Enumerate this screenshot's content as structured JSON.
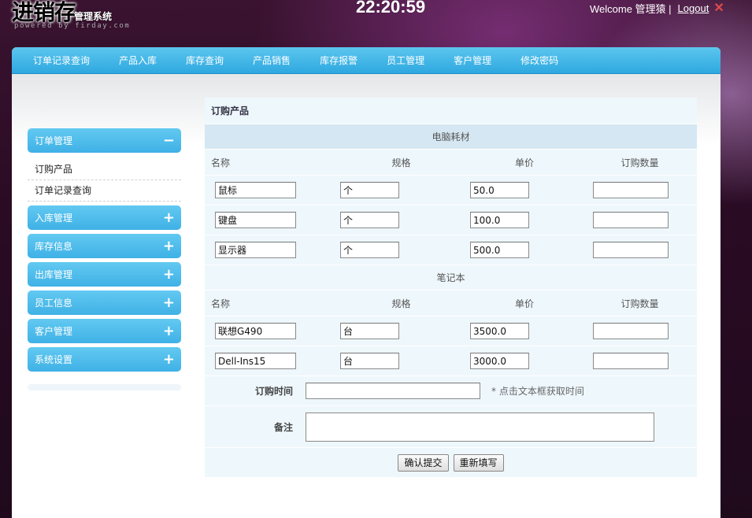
{
  "header": {
    "logo_main": "进销存",
    "logo_sub": "管理系统",
    "powered": "powered by firday.com",
    "clock": "22:20:59",
    "welcome": "Welcome 管理猿 |",
    "logout": "Logout"
  },
  "nav": [
    "订单记录查询",
    "产品入库",
    "库存查询",
    "产品销售",
    "库存报警",
    "员工管理",
    "客户管理",
    "修改密码"
  ],
  "sidebar": {
    "open_section": "订单管理",
    "open_symbol": "−",
    "sub_items": [
      "订购产品",
      "订单记录查询"
    ],
    "sections": [
      "入库管理",
      "库存信息",
      "出库管理",
      "员工信息",
      "客户管理",
      "系统设置"
    ],
    "closed_symbol": "+"
  },
  "form": {
    "title": "订购产品",
    "headers": [
      "名称",
      "规格",
      "单价",
      "订购数量"
    ],
    "categories": [
      {
        "name": "电脑耗材",
        "items": [
          {
            "name": "鼠标",
            "spec": "个",
            "price": "50.0",
            "qty": ""
          },
          {
            "name": "键盘",
            "spec": "个",
            "price": "100.0",
            "qty": ""
          },
          {
            "name": "显示器",
            "spec": "个",
            "price": "500.0",
            "qty": ""
          }
        ]
      },
      {
        "name": "笔记本",
        "items": [
          {
            "name": "联想G490",
            "spec": "台",
            "price": "3500.0",
            "qty": ""
          },
          {
            "name": "Dell-Ins15",
            "spec": "台",
            "price": "3000.0",
            "qty": ""
          }
        ]
      }
    ],
    "time_label": "订购时间",
    "time_value": "",
    "time_hint": "* 点击文本框获取时间",
    "note_label": "备注",
    "note_value": "",
    "submit": "确认提交",
    "reset": "重新填写"
  },
  "colors": {
    "nav_bar": "#2ea8e0",
    "sidebar_header": "#3fb1e6",
    "panel_bg": "#eef7fc",
    "category_bg": "#d5e7f2"
  }
}
